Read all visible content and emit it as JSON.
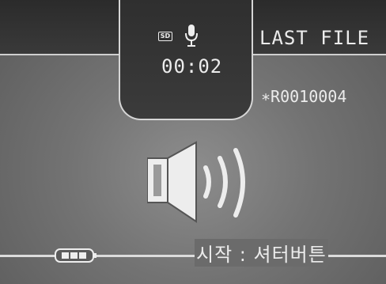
{
  "status": {
    "card_badge": "SD",
    "mode_icon": "microphone-icon",
    "elapsed_time": "00:02",
    "last_file_label": "LAST FILE",
    "file_id": "∗R0010004"
  },
  "center": {
    "icon": "speaker-icon"
  },
  "footer": {
    "battery_icon": "battery-icon",
    "hint": "시작 : 셔터버튼"
  }
}
